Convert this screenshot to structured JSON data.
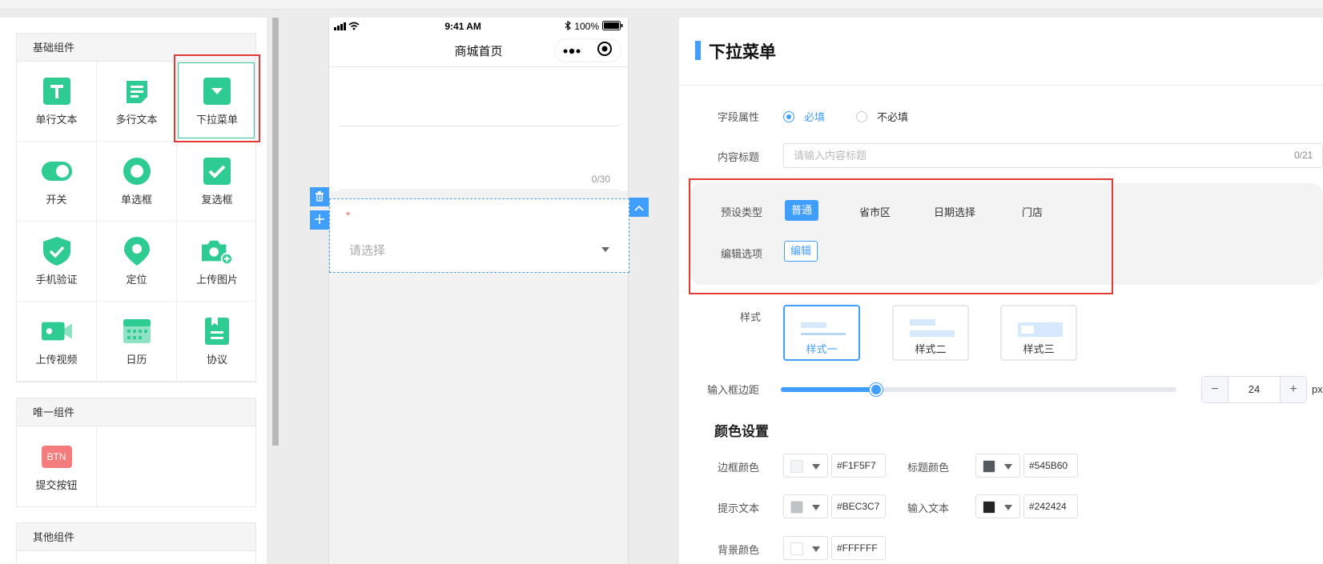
{
  "palette": {
    "basic": {
      "title": "基础组件",
      "items": [
        {
          "label": "单行文本",
          "icon": "text-t-icon"
        },
        {
          "label": "多行文本",
          "icon": "multiline-text-icon"
        },
        {
          "label": "下拉菜单",
          "icon": "dropdown-icon"
        },
        {
          "label": "开关",
          "icon": "toggle-icon"
        },
        {
          "label": "单选框",
          "icon": "radio-icon"
        },
        {
          "label": "复选框",
          "icon": "checkbox-icon"
        },
        {
          "label": "手机验证",
          "icon": "shield-check-icon"
        },
        {
          "label": "定位",
          "icon": "location-pin-icon"
        },
        {
          "label": "上传图片",
          "icon": "camera-icon"
        },
        {
          "label": "上传视频",
          "icon": "video-icon"
        },
        {
          "label": "日历",
          "icon": "calendar-icon"
        },
        {
          "label": "协议",
          "icon": "document-icon"
        }
      ]
    },
    "unique": {
      "title": "唯一组件",
      "items": [
        {
          "label": "提交按钮",
          "icon": "btn-icon",
          "icon_text": "BTN"
        }
      ]
    },
    "other": {
      "title": "其他组件"
    }
  },
  "phone": {
    "status_time": "9:41 AM",
    "status_battery": "100%",
    "nav_title": "商城首页",
    "text_count": "0/30",
    "required_mark": "*",
    "select_placeholder": "请选择"
  },
  "settings": {
    "title": "下拉菜单",
    "field_attr_label": "字段属性",
    "required_option": "必填",
    "optional_option": "不必填",
    "content_title_label": "内容标题",
    "content_title_placeholder": "请输入内容标题",
    "content_title_count": "0/21",
    "preset_type_label": "预设类型",
    "preset_types": [
      "普通",
      "省市区",
      "日期选择",
      "门店"
    ],
    "edit_options_label": "编辑选项",
    "edit_button": "编辑",
    "style_label": "样式",
    "styles": [
      "样式一",
      "样式二",
      "样式三"
    ],
    "margin_label": "输入框边距",
    "margin_value": "24",
    "margin_min": 0,
    "margin_max": 100,
    "margin_unit": "px",
    "color_section_title": "颜色设置",
    "colors": {
      "border": {
        "label": "边框颜色",
        "value": "#F1F5F7"
      },
      "title": {
        "label": "标题颜色",
        "value": "#545B60"
      },
      "hint": {
        "label": "提示文本",
        "value": "#BEC3C7"
      },
      "input": {
        "label": "输入文本",
        "value": "#242424"
      },
      "background": {
        "label": "背景颜色",
        "value": "#FFFFFF"
      }
    }
  },
  "theme": {
    "accent": "#409eff",
    "icon_green": "#2ecc92",
    "highlight_red": "#e53935"
  }
}
